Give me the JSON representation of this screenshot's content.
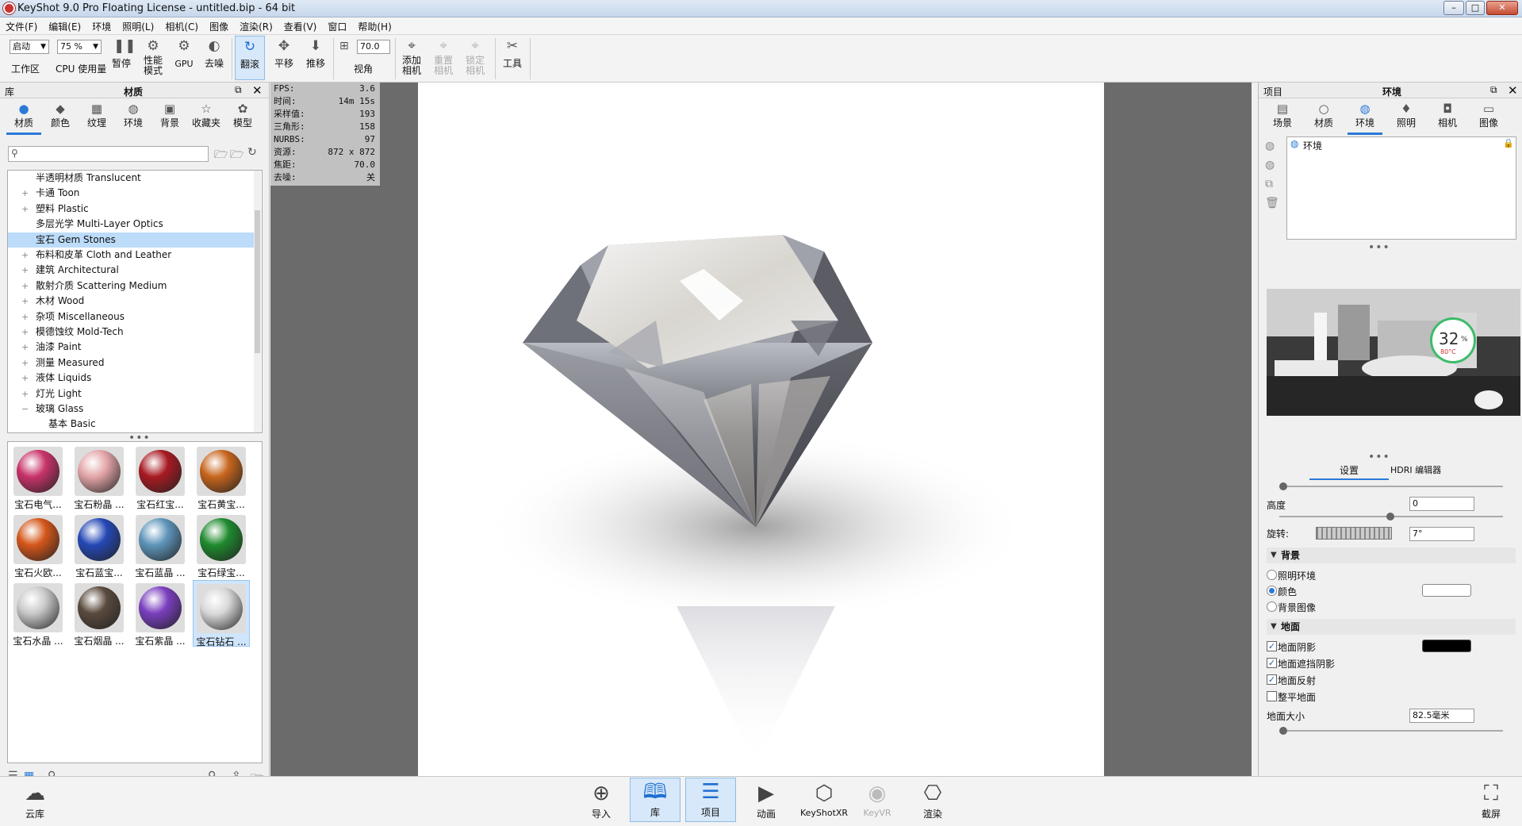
{
  "window": {
    "title": "KeyShot 9.0 Pro Floating License  - untitled.bip  - 64 bit"
  },
  "menu": [
    "文件(F)",
    "编辑(E)",
    "环境",
    "照明(L)",
    "相机(C)",
    "图像",
    "渲染(R)",
    "查看(V)",
    "窗口",
    "帮助(H)"
  ],
  "toolbar": {
    "startup_value": "启动",
    "workspace_label": "工作区",
    "percent_value": "75 %",
    "cpu_label": "CPU 使用量",
    "pause_label": "暂停",
    "perf_label": "性能\n模式",
    "gpu_label": "GPU",
    "denoise_label": "去噪",
    "tumble_label": "翻滚",
    "pan_label": "平移",
    "push_label": "推移",
    "fov_value": "70.0",
    "fov_label": "视角",
    "add_camera_label": "添加\n相机",
    "reset_camera_label": "重置\n相机",
    "lock_camera_label": "锁定\n相机",
    "tools_label": "工具"
  },
  "library": {
    "header_left": "库",
    "header_title": "材质",
    "tabs": [
      {
        "label": "材质",
        "icon": "material-icon"
      },
      {
        "label": "颜色",
        "icon": "color-icon"
      },
      {
        "label": "纹理",
        "icon": "texture-icon"
      },
      {
        "label": "环境",
        "icon": "environment-icon"
      },
      {
        "label": "背景",
        "icon": "background-icon"
      },
      {
        "label": "收藏夹",
        "icon": "favorites-icon"
      },
      {
        "label": "模型",
        "icon": "model-icon"
      }
    ],
    "search_placeholder": "",
    "tree": [
      {
        "label": "半透明材质 Translucent",
        "expander": ""
      },
      {
        "label": "卡通 Toon",
        "expander": "+"
      },
      {
        "label": "塑料 Plastic",
        "expander": "+"
      },
      {
        "label": "多层光学 Multi-Layer Optics",
        "expander": ""
      },
      {
        "label": "宝石 Gem Stones",
        "expander": ""
      },
      {
        "label": "布料和皮革 Cloth and Leather",
        "expander": "+"
      },
      {
        "label": "建筑 Architectural",
        "expander": "+"
      },
      {
        "label": "散射介质 Scattering Medium",
        "expander": "+"
      },
      {
        "label": "木材 Wood",
        "expander": "+"
      },
      {
        "label": "杂项 Miscellaneous",
        "expander": "+"
      },
      {
        "label": "模德蚀纹 Mold-Tech",
        "expander": "+"
      },
      {
        "label": "油漆 Paint",
        "expander": "+"
      },
      {
        "label": "测量 Measured",
        "expander": "+"
      },
      {
        "label": "液体 Liquids",
        "expander": "+"
      },
      {
        "label": "灯光 Light",
        "expander": "+"
      },
      {
        "label": "玻璃 Glass",
        "expander": "−"
      },
      {
        "label": "基本 Basic",
        "expander": ""
      }
    ],
    "selected_tree_index": 4,
    "thumbnails": [
      {
        "label": "宝石电气...",
        "color": "#c8336a"
      },
      {
        "label": "宝石粉晶 ...",
        "color": "#e3a5a8"
      },
      {
        "label": "宝石红宝...",
        "color": "#a81a22"
      },
      {
        "label": "宝石黄宝...",
        "color": "#c7651d"
      },
      {
        "label": "宝石火欧...",
        "color": "#d4561a"
      },
      {
        "label": "宝石蓝宝...",
        "color": "#2448b5"
      },
      {
        "label": "宝石蓝晶 ...",
        "color": "#5e95ba"
      },
      {
        "label": "宝石绿宝...",
        "color": "#1f8a2e"
      },
      {
        "label": "宝石水晶 ...",
        "color": "#c9c9c9"
      },
      {
        "label": "宝石烟晶 ...",
        "color": "#5a4a3d"
      },
      {
        "label": "宝石紫晶 ...",
        "color": "#7a3fbf"
      },
      {
        "label": "宝石钻石 ...",
        "color": "#d8d8d8"
      }
    ],
    "selected_thumb_index": 11
  },
  "stats": [
    {
      "k": "FPS:",
      "v": "3.6"
    },
    {
      "k": "时间:",
      "v": "14m 15s"
    },
    {
      "k": "采样值:",
      "v": "193"
    },
    {
      "k": "三角形:",
      "v": "158"
    },
    {
      "k": "NURBS:",
      "v": "97"
    },
    {
      "k": "资源:",
      "v": "872 x 872"
    },
    {
      "k": "焦距:",
      "v": "70.0"
    },
    {
      "k": "去噪:",
      "v": "关"
    }
  ],
  "project": {
    "header_left": "项目",
    "header_title": "环境",
    "tabs": [
      {
        "label": "场景",
        "icon": "scene-icon"
      },
      {
        "label": "材质",
        "icon": "material-icon"
      },
      {
        "label": "环境",
        "icon": "environment-icon"
      },
      {
        "label": "照明",
        "icon": "lighting-icon"
      },
      {
        "label": "相机",
        "icon": "camera-icon"
      },
      {
        "label": "图像",
        "icon": "image-icon"
      }
    ],
    "env_item": "环境",
    "gauge_percent": "32",
    "gauge_unit": "%",
    "gauge_temp": "80°C",
    "subtabs": [
      "设置",
      "HDRI 编辑器"
    ],
    "height_label": "高度",
    "height_value": "0",
    "rotation_label": "旋转:",
    "rotation_value": "7°",
    "background_header": "背景",
    "bg_options": [
      "照明环境",
      "颜色",
      "背景图像"
    ],
    "bg_selected": 1,
    "bg_color": "#ffffff",
    "ground_header": "地面",
    "ground_options": [
      {
        "label": "地面阴影",
        "checked": true
      },
      {
        "label": "地面遮挡阴影",
        "checked": true
      },
      {
        "label": "地面反射",
        "checked": true
      },
      {
        "label": "整平地面",
        "checked": false
      }
    ],
    "ground_shadow_color": "#000000",
    "ground_size_label": "地面大小",
    "ground_size_value": "82.5毫米"
  },
  "bottom": {
    "cloud_label": "云库",
    "import_label": "导入",
    "library_label": "库",
    "project_label": "项目",
    "animation_label": "动画",
    "keyshotxr_label": "KeyShotXR",
    "keyvr_label": "KeyVR",
    "render_label": "渲染",
    "screenshot_label": "截屏"
  },
  "colors": {
    "accent": "#2a7ad8",
    "selection": "#bcdcfa"
  }
}
